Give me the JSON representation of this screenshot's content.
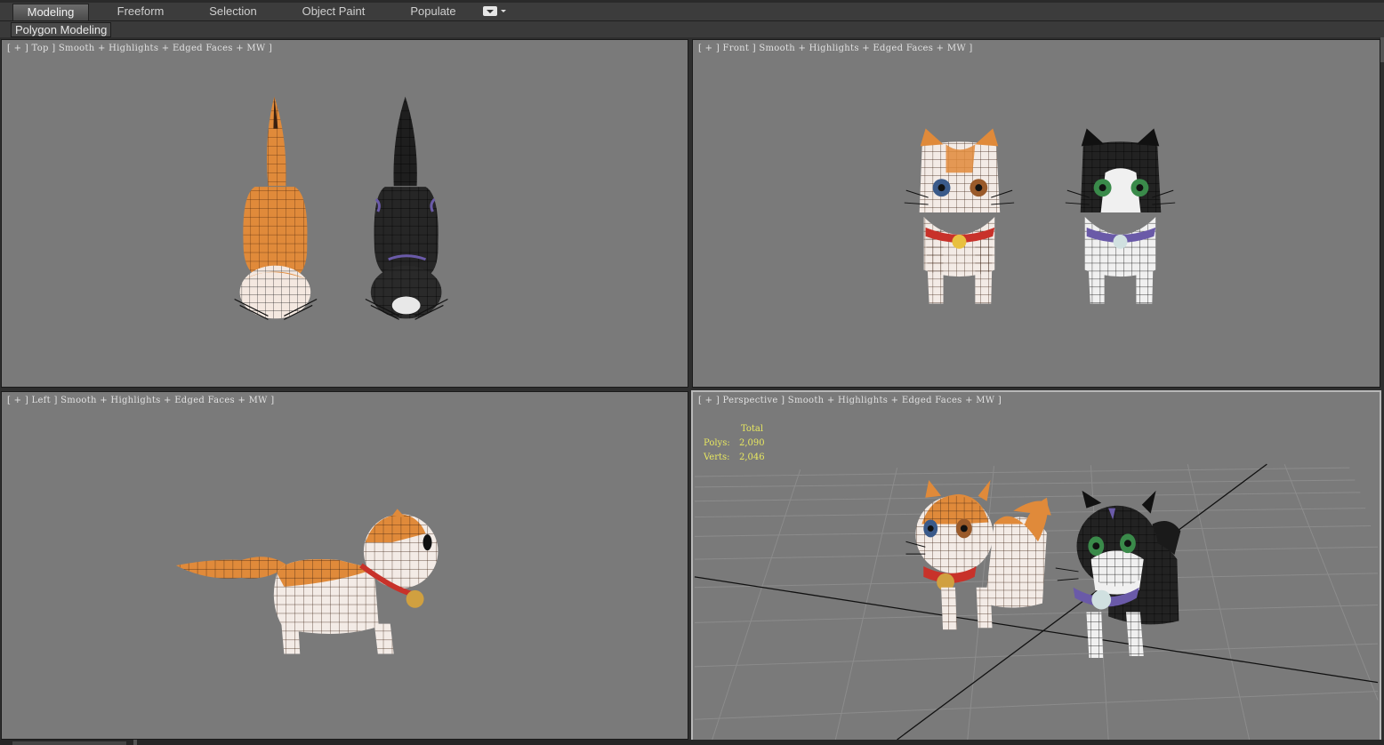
{
  "ribbon": {
    "tabs": [
      {
        "label": "Modeling",
        "active": true
      },
      {
        "label": "Freeform",
        "active": false
      },
      {
        "label": "Selection",
        "active": false
      },
      {
        "label": "Object Paint",
        "active": false
      },
      {
        "label": "Populate",
        "active": false
      }
    ],
    "dropdown_icon": "ribbon-options-icon"
  },
  "subribbon": {
    "panel_label": "Polygon Modeling"
  },
  "viewports": {
    "top": {
      "label": "[ + ] Top ] Smooth + Highlights + Edged Faces + MW ]"
    },
    "front": {
      "label": "[ + ] Front ] Smooth + Highlights + Edged Faces + MW ]"
    },
    "left": {
      "label": "[ + ] Left ] Smooth + Highlights + Edged Faces + MW ]"
    },
    "perspective": {
      "label": "[ + ] Perspective ] Smooth + Highlights + Edged Faces + MW ]",
      "stats": {
        "header": "Total",
        "polys_label": "Polys:",
        "polys_value": "2,090",
        "verts_label": "Verts:",
        "verts_value": "2,046"
      }
    }
  },
  "colors": {
    "viewport_bg": "#7a7a7a",
    "orange_cat": "#e08a3a",
    "black_cat": "#222222",
    "stats_text": "#e8e860"
  }
}
